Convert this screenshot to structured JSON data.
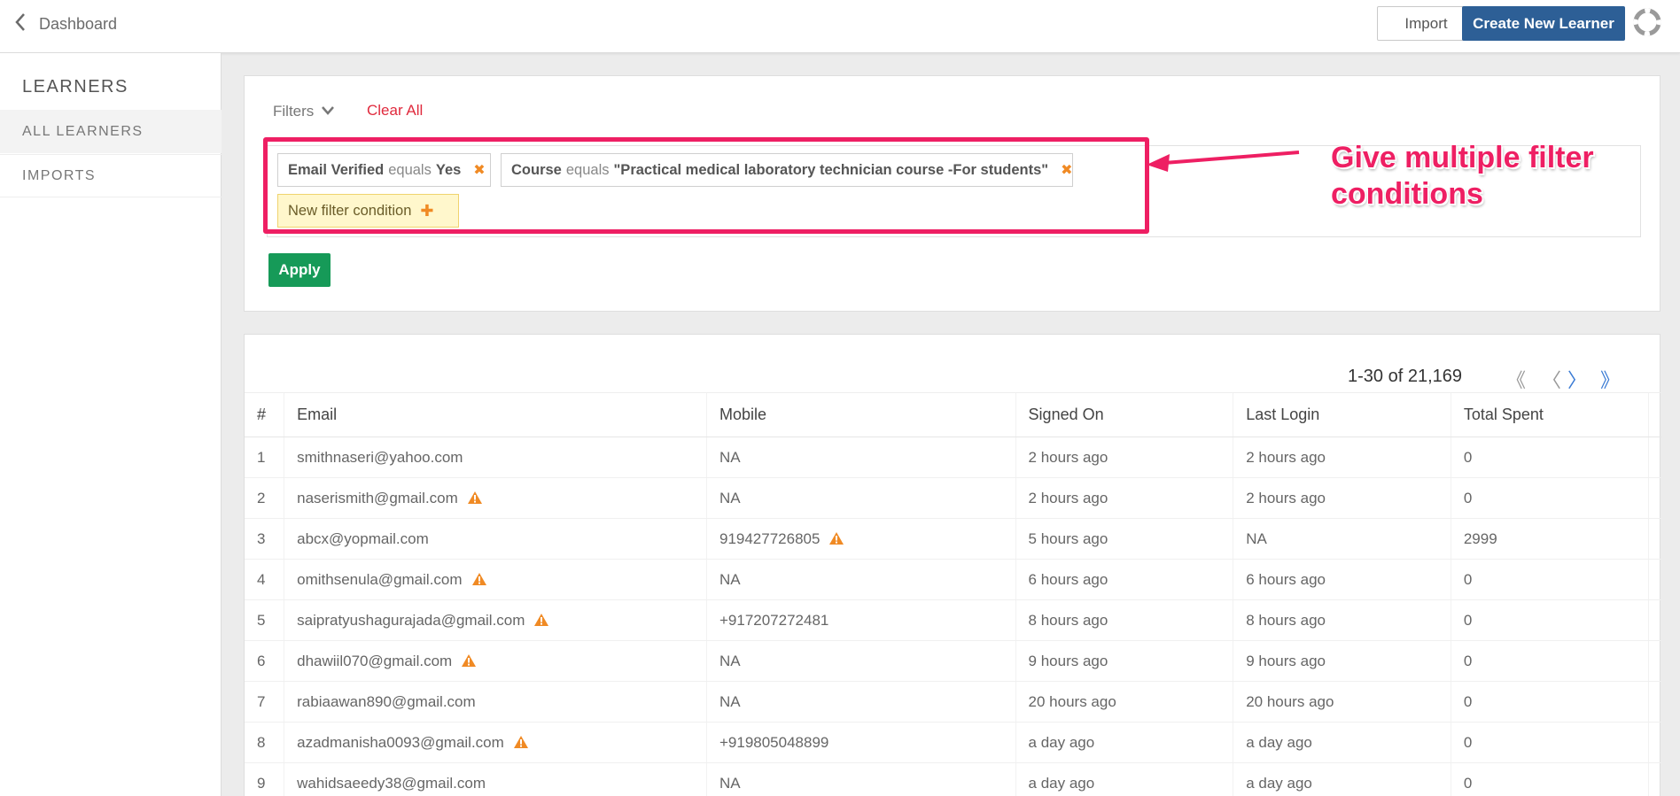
{
  "header": {
    "back_label": "Dashboard",
    "import_label": "Import",
    "create_label": "Create New Learner"
  },
  "sidebar": {
    "title": "LEARNERS",
    "items": [
      {
        "label": "ALL LEARNERS",
        "active": true
      },
      {
        "label": "IMPORTS",
        "active": false
      }
    ]
  },
  "filters": {
    "toggle_label": "Filters",
    "clear_label": "Clear All",
    "conditions": [
      {
        "field": "Email Verified",
        "op": "equals",
        "value": "Yes"
      },
      {
        "field": "Course",
        "op": "equals",
        "value": "\"Practical medical laboratory technician course -For students\""
      }
    ],
    "new_condition_label": "New filter condition",
    "apply_label": "Apply"
  },
  "annotation": {
    "line1": "Give multiple filter",
    "line2": "conditions",
    "color": "#ee1f63"
  },
  "pagination": {
    "text": "1-30 of 21,169"
  },
  "table": {
    "headers": [
      "#",
      "Email",
      "Mobile",
      "Signed On",
      "Last Login",
      "Total Spent"
    ],
    "rows": [
      {
        "n": "1",
        "email": "smithnaseri@yahoo.com",
        "email_warn": false,
        "mobile": "NA",
        "mobile_warn": false,
        "signed": "2 hours ago",
        "login": "2 hours ago",
        "spent": "0"
      },
      {
        "n": "2",
        "email": "naserismith@gmail.com",
        "email_warn": true,
        "mobile": "NA",
        "mobile_warn": false,
        "signed": "2 hours ago",
        "login": "2 hours ago",
        "spent": "0"
      },
      {
        "n": "3",
        "email": "abcx@yopmail.com",
        "email_warn": false,
        "mobile": "919427726805",
        "mobile_warn": true,
        "signed": "5 hours ago",
        "login": "NA",
        "spent": "2999"
      },
      {
        "n": "4",
        "email": "omithsenula@gmail.com",
        "email_warn": true,
        "mobile": "NA",
        "mobile_warn": false,
        "signed": "6 hours ago",
        "login": "6 hours ago",
        "spent": "0"
      },
      {
        "n": "5",
        "email": "saipratyushagurajada@gmail.com",
        "email_warn": true,
        "mobile": "+917207272481",
        "mobile_warn": false,
        "signed": "8 hours ago",
        "login": "8 hours ago",
        "spent": "0"
      },
      {
        "n": "6",
        "email": "dhawiil070@gmail.com",
        "email_warn": true,
        "mobile": "NA",
        "mobile_warn": false,
        "signed": "9 hours ago",
        "login": "9 hours ago",
        "spent": "0"
      },
      {
        "n": "7",
        "email": "rabiaawan890@gmail.com",
        "email_warn": false,
        "mobile": "NA",
        "mobile_warn": false,
        "signed": "20 hours ago",
        "login": "20 hours ago",
        "spent": "0"
      },
      {
        "n": "8",
        "email": "azadmanisha0093@gmail.com",
        "email_warn": true,
        "mobile": "+919805048899",
        "mobile_warn": false,
        "signed": "a day ago",
        "login": "a day ago",
        "spent": "0"
      },
      {
        "n": "9",
        "email": "wahidsaeedy38@gmail.com",
        "email_warn": false,
        "mobile": "NA",
        "mobile_warn": false,
        "signed": "a day ago",
        "login": "a day ago",
        "spent": "0"
      }
    ]
  },
  "colors": {
    "primary": "#2d5f96",
    "apply": "#169a58",
    "clear": "#e02a3d",
    "warning": "#f08a24"
  }
}
